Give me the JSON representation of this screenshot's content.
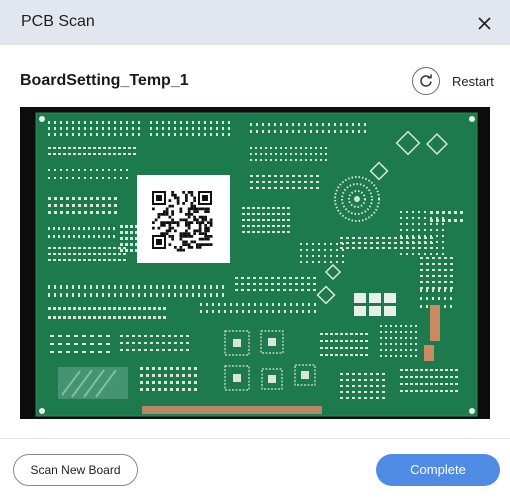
{
  "window": {
    "title": "PCB Scan"
  },
  "board": {
    "name": "BoardSetting_Temp_1"
  },
  "restart": {
    "label": "Restart",
    "icon": "refresh-icon"
  },
  "footer": {
    "scan_new_board_label": "Scan New Board",
    "complete_label": "Complete"
  },
  "colors": {
    "accent": "#4f8be4",
    "title_bar": "#e2e6ee",
    "pcb_green": "#1f7a4d"
  }
}
